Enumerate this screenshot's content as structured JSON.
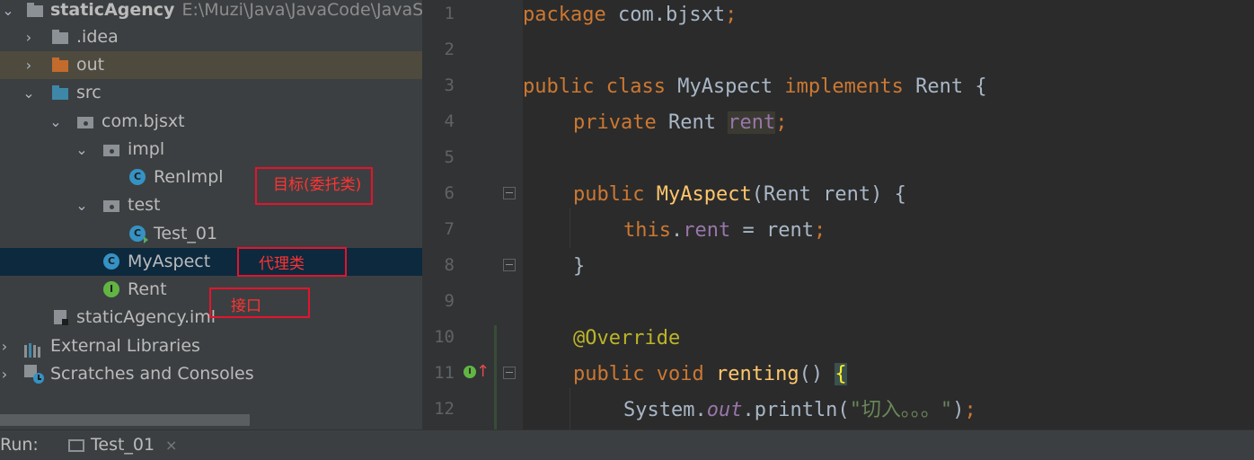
{
  "project_tree": {
    "root": {
      "name": "staticAgency",
      "path": "E:\\Muzi\\Java\\JavaCode\\JavaS"
    },
    "items": [
      {
        "label": ".idea",
        "icon": "folder-icon"
      },
      {
        "label": "out",
        "icon": "folder-icon"
      },
      {
        "label": "src",
        "icon": "source-folder-icon"
      },
      {
        "label": "com.bjsxt",
        "icon": "package-icon"
      },
      {
        "label": "impl",
        "icon": "package-icon"
      },
      {
        "label": "RenImpl",
        "icon": "class-icon"
      },
      {
        "label": "test",
        "icon": "package-icon"
      },
      {
        "label": "Test_01",
        "icon": "runnable-class-icon"
      },
      {
        "label": "MyAspect",
        "icon": "class-icon"
      },
      {
        "label": "Rent",
        "icon": "interface-icon"
      },
      {
        "label": "staticAgency.iml",
        "icon": "module-file-icon"
      },
      {
        "label": "External Libraries",
        "icon": "libraries-icon"
      },
      {
        "label": "Scratches and Consoles",
        "icon": "scratches-icon"
      }
    ],
    "annotations": [
      {
        "text": "目标(委托类)"
      },
      {
        "text": "代理类"
      },
      {
        "text": "接口"
      }
    ]
  },
  "editor": {
    "line_numbers": [
      "1",
      "2",
      "3",
      "4",
      "5",
      "6",
      "7",
      "8",
      "9",
      "10",
      "11",
      "12"
    ],
    "code": {
      "l1_kw": "package",
      "l1_rest": " com.bjsxt",
      "l1_semi": ";",
      "l3_kw1": "public class",
      "l3_name": " MyAspect ",
      "l3_kw2": "implements",
      "l3_rest": " Rent {",
      "l4_kw": "private",
      "l4_type": " Rent ",
      "l4_field": "rent",
      "l4_semi": ";",
      "l6_kw": "public",
      "l6_name": "MyAspect",
      "l6_rest": "(Rent rent) {",
      "l7_kw": "this",
      "l7_dot": ".",
      "l7_field": "rent",
      "l7_rest": " = rent",
      "l7_semi": ";",
      "l8": "}",
      "l10": "@Override",
      "l11_kw": "public void",
      "l11_name": "renting",
      "l11_paren": "() ",
      "l11_brace": "{",
      "l12_sys": "System.",
      "l12_out": "out",
      "l12_call": ".println(",
      "l12_str": "\"切入。。。\"",
      "l12_end": ")",
      "l12_semi": ";"
    }
  },
  "run_bar": {
    "label": "Run:",
    "tab": "Test_01",
    "close": "×"
  },
  "colors": {
    "keyword": "#cc7832",
    "function": "#ffc66d",
    "field": "#9876aa",
    "annotation": "#bbb529",
    "string": "#6a8759",
    "annotation_box": "#e3142d"
  }
}
